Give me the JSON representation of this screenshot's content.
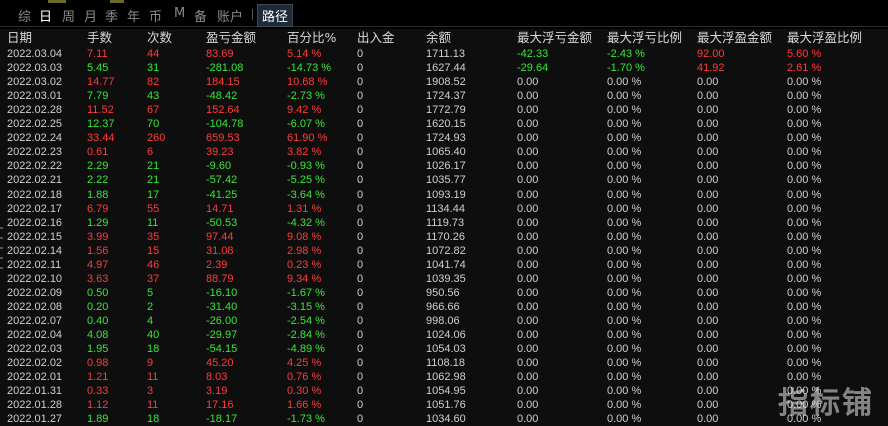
{
  "tabs": [
    "综",
    "日",
    "周",
    "月",
    "季",
    "年",
    "币",
    "M",
    "备",
    "账户",
    "路径"
  ],
  "active_tab": "日",
  "headers": [
    "日期",
    "手数",
    "次数",
    "盈亏金额",
    "百分比%",
    "出入金",
    "余额",
    "最大浮亏金额",
    "最大浮亏比例",
    "最大浮盈金额",
    "最大浮盈比例"
  ],
  "colors": {
    "red": "#ff3b3b",
    "green": "#39e639",
    "white": "#d0d0d0"
  },
  "rows": [
    {
      "date": "2022.03.04",
      "lots": "7.11",
      "count": "44",
      "pnl": "83.69",
      "pct": "5.14 %",
      "io": "0",
      "bal": "1711.13",
      "maxloss": "-42.33",
      "maxlosspct": "-2.43 %",
      "maxgain": "92.00",
      "maxgainpct": "5.60 %",
      "c": "red",
      "lc": "green",
      "gc": "red"
    },
    {
      "date": "2022.03.03",
      "lots": "5.45",
      "count": "31",
      "pnl": "-281.08",
      "pct": "-14.73 %",
      "io": "0",
      "bal": "1627.44",
      "maxloss": "-29.64",
      "maxlosspct": "-1.70 %",
      "maxgain": "41.92",
      "maxgainpct": "2.61 %",
      "c": "green",
      "lc": "green",
      "gc": "red"
    },
    {
      "date": "2022.03.02",
      "lots": "14.77",
      "count": "82",
      "pnl": "184.15",
      "pct": "10.68 %",
      "io": "0",
      "bal": "1908.52",
      "maxloss": "0.00",
      "maxlosspct": "0.00 %",
      "maxgain": "0.00",
      "maxgainpct": "0.00 %",
      "c": "red",
      "lc": "white",
      "gc": "white"
    },
    {
      "date": "2022.03.01",
      "lots": "7.79",
      "count": "43",
      "pnl": "-48.42",
      "pct": "-2.73 %",
      "io": "0",
      "bal": "1724.37",
      "maxloss": "0.00",
      "maxlosspct": "0.00 %",
      "maxgain": "0.00",
      "maxgainpct": "0.00 %",
      "c": "green",
      "lc": "white",
      "gc": "white"
    },
    {
      "date": "2022.02.28",
      "lots": "11.52",
      "count": "67",
      "pnl": "152.64",
      "pct": "9.42 %",
      "io": "0",
      "bal": "1772.79",
      "maxloss": "0.00",
      "maxlosspct": "0.00 %",
      "maxgain": "0.00",
      "maxgainpct": "0.00 %",
      "c": "red",
      "lc": "white",
      "gc": "white"
    },
    {
      "date": "2022.02.25",
      "lots": "12.37",
      "count": "70",
      "pnl": "-104.78",
      "pct": "-6.07 %",
      "io": "0",
      "bal": "1620.15",
      "maxloss": "0.00",
      "maxlosspct": "0.00 %",
      "maxgain": "0.00",
      "maxgainpct": "0.00 %",
      "c": "green",
      "lc": "white",
      "gc": "white"
    },
    {
      "date": "2022.02.24",
      "lots": "33.44",
      "count": "260",
      "pnl": "659.53",
      "pct": "61.90 %",
      "io": "0",
      "bal": "1724.93",
      "maxloss": "0.00",
      "maxlosspct": "0.00 %",
      "maxgain": "0.00",
      "maxgainpct": "0.00 %",
      "c": "red",
      "lc": "white",
      "gc": "white"
    },
    {
      "date": "2022.02.23",
      "lots": "0.61",
      "count": "6",
      "pnl": "39.23",
      "pct": "3.82 %",
      "io": "0",
      "bal": "1065.40",
      "maxloss": "0.00",
      "maxlosspct": "0.00 %",
      "maxgain": "0.00",
      "maxgainpct": "0.00 %",
      "c": "red",
      "lc": "white",
      "gc": "white"
    },
    {
      "date": "2022.02.22",
      "lots": "2.29",
      "count": "21",
      "pnl": "-9.60",
      "pct": "-0.93 %",
      "io": "0",
      "bal": "1026.17",
      "maxloss": "0.00",
      "maxlosspct": "0.00 %",
      "maxgain": "0.00",
      "maxgainpct": "0.00 %",
      "c": "green",
      "lc": "white",
      "gc": "white"
    },
    {
      "date": "2022.02.21",
      "lots": "2.22",
      "count": "21",
      "pnl": "-57.42",
      "pct": "-5.25 %",
      "io": "0",
      "bal": "1035.77",
      "maxloss": "0.00",
      "maxlosspct": "0.00 %",
      "maxgain": "0.00",
      "maxgainpct": "0.00 %",
      "c": "green",
      "lc": "white",
      "gc": "white"
    },
    {
      "date": "2022.02.18",
      "lots": "1.88",
      "count": "17",
      "pnl": "-41.25",
      "pct": "-3.64 %",
      "io": "0",
      "bal": "1093.19",
      "maxloss": "0.00",
      "maxlosspct": "0.00 %",
      "maxgain": "0.00",
      "maxgainpct": "0.00 %",
      "c": "green",
      "lc": "white",
      "gc": "white"
    },
    {
      "date": "2022.02.17",
      "lots": "6.79",
      "count": "55",
      "pnl": "14.71",
      "pct": "1.31 %",
      "io": "0",
      "bal": "1134.44",
      "maxloss": "0.00",
      "maxlosspct": "0.00 %",
      "maxgain": "0.00",
      "maxgainpct": "0.00 %",
      "c": "red",
      "lc": "white",
      "gc": "white"
    },
    {
      "date": "2022.02.16",
      "lots": "1.29",
      "count": "11",
      "pnl": "-50.53",
      "pct": "-4.32 %",
      "io": "0",
      "bal": "1119.73",
      "maxloss": "0.00",
      "maxlosspct": "0.00 %",
      "maxgain": "0.00",
      "maxgainpct": "0.00 %",
      "c": "green",
      "lc": "white",
      "gc": "white"
    },
    {
      "date": "2022.02.15",
      "lots": "3.99",
      "count": "35",
      "pnl": "97.44",
      "pct": "9.08 %",
      "io": "0",
      "bal": "1170.26",
      "maxloss": "0.00",
      "maxlosspct": "0.00 %",
      "maxgain": "0.00",
      "maxgainpct": "0.00 %",
      "c": "red",
      "lc": "white",
      "gc": "white"
    },
    {
      "date": "2022.02.14",
      "lots": "1.56",
      "count": "15",
      "pnl": "31.08",
      "pct": "2.98 %",
      "io": "0",
      "bal": "1072.82",
      "maxloss": "0.00",
      "maxlosspct": "0.00 %",
      "maxgain": "0.00",
      "maxgainpct": "0.00 %",
      "c": "red",
      "lc": "white",
      "gc": "white"
    },
    {
      "date": "2022.02.11",
      "lots": "4.97",
      "count": "46",
      "pnl": "2.39",
      "pct": "0.23 %",
      "io": "0",
      "bal": "1041.74",
      "maxloss": "0.00",
      "maxlosspct": "0.00 %",
      "maxgain": "0.00",
      "maxgainpct": "0.00 %",
      "c": "red",
      "lc": "white",
      "gc": "white"
    },
    {
      "date": "2022.02.10",
      "lots": "3.63",
      "count": "37",
      "pnl": "88.79",
      "pct": "9.34 %",
      "io": "0",
      "bal": "1039.35",
      "maxloss": "0.00",
      "maxlosspct": "0.00 %",
      "maxgain": "0.00",
      "maxgainpct": "0.00 %",
      "c": "red",
      "lc": "white",
      "gc": "white"
    },
    {
      "date": "2022.02.09",
      "lots": "0.50",
      "count": "5",
      "pnl": "-16.10",
      "pct": "-1.67 %",
      "io": "0",
      "bal": "950.56",
      "maxloss": "0.00",
      "maxlosspct": "0.00 %",
      "maxgain": "0.00",
      "maxgainpct": "0.00 %",
      "c": "green",
      "lc": "white",
      "gc": "white"
    },
    {
      "date": "2022.02.08",
      "lots": "0.20",
      "count": "2",
      "pnl": "-31.40",
      "pct": "-3.15 %",
      "io": "0",
      "bal": "966.66",
      "maxloss": "0.00",
      "maxlosspct": "0.00 %",
      "maxgain": "0.00",
      "maxgainpct": "0.00 %",
      "c": "green",
      "lc": "white",
      "gc": "white"
    },
    {
      "date": "2022.02.07",
      "lots": "0.40",
      "count": "4",
      "pnl": "-26.00",
      "pct": "-2.54 %",
      "io": "0",
      "bal": "998.06",
      "maxloss": "0.00",
      "maxlosspct": "0.00 %",
      "maxgain": "0.00",
      "maxgainpct": "0.00 %",
      "c": "green",
      "lc": "white",
      "gc": "white"
    },
    {
      "date": "2022.02.04",
      "lots": "4.08",
      "count": "40",
      "pnl": "-29.97",
      "pct": "-2.84 %",
      "io": "0",
      "bal": "1024.06",
      "maxloss": "0.00",
      "maxlosspct": "0.00 %",
      "maxgain": "0.00",
      "maxgainpct": "0.00 %",
      "c": "green",
      "lc": "white",
      "gc": "white"
    },
    {
      "date": "2022.02.03",
      "lots": "1.95",
      "count": "18",
      "pnl": "-54.15",
      "pct": "-4.89 %",
      "io": "0",
      "bal": "1054.03",
      "maxloss": "0.00",
      "maxlosspct": "0.00 %",
      "maxgain": "0.00",
      "maxgainpct": "0.00 %",
      "c": "green",
      "lc": "white",
      "gc": "white"
    },
    {
      "date": "2022.02.02",
      "lots": "0.98",
      "count": "9",
      "pnl": "45.20",
      "pct": "4.25 %",
      "io": "0",
      "bal": "1108.18",
      "maxloss": "0.00",
      "maxlosspct": "0.00 %",
      "maxgain": "0.00",
      "maxgainpct": "0.00 %",
      "c": "red",
      "lc": "white",
      "gc": "white"
    },
    {
      "date": "2022.02.01",
      "lots": "1.21",
      "count": "11",
      "pnl": "8.03",
      "pct": "0.76 %",
      "io": "0",
      "bal": "1062.98",
      "maxloss": "0.00",
      "maxlosspct": "0.00 %",
      "maxgain": "0.00",
      "maxgainpct": "0.00 %",
      "c": "red",
      "lc": "white",
      "gc": "white"
    },
    {
      "date": "2022.01.31",
      "lots": "0.33",
      "count": "3",
      "pnl": "3.19",
      "pct": "0.30 %",
      "io": "0",
      "bal": "1054.95",
      "maxloss": "0.00",
      "maxlosspct": "0.00 %",
      "maxgain": "0.00",
      "maxgainpct": "0.00 %",
      "c": "red",
      "lc": "white",
      "gc": "white"
    },
    {
      "date": "2022.01.28",
      "lots": "1.12",
      "count": "11",
      "pnl": "17.16",
      "pct": "1.66 %",
      "io": "0",
      "bal": "1051.76",
      "maxloss": "0.00",
      "maxlosspct": "0.00 %",
      "maxgain": "0.00",
      "maxgainpct": "0.00 %",
      "c": "red",
      "lc": "white",
      "gc": "white"
    },
    {
      "date": "2022.01.27",
      "lots": "1.89",
      "count": "18",
      "pnl": "-18.17",
      "pct": "-1.73 %",
      "io": "0",
      "bal": "1034.60",
      "maxloss": "0.00",
      "maxlosspct": "0.00 %",
      "maxgain": "0.00",
      "maxgainpct": "0.00 %",
      "c": "green",
      "lc": "white",
      "gc": "white"
    }
  ],
  "watermark": "指标铺"
}
